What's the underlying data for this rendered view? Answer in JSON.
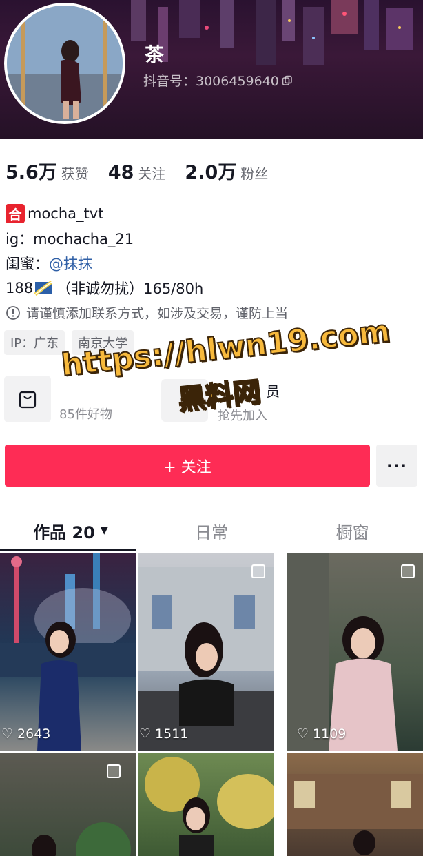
{
  "profile": {
    "nickname": "茶",
    "douyin_id": "抖音号：3006459640",
    "stats": [
      {
        "value": "5.6万",
        "label": "获赞"
      },
      {
        "value": "48",
        "label": "关注"
      },
      {
        "value": "2.0万",
        "label": "粉丝"
      }
    ],
    "bio": {
      "tag_char": "合",
      "line1": "mocha_tvt",
      "line2": "ig：mochacha_21",
      "line3_prefix": "闺蜜：",
      "line3_link": "@抹抹",
      "line4_a": "188",
      "line4_b": "（非诚勿扰）165/80h"
    },
    "notice": "请谨慎添加联系方式，如涉及交易，谨防上当",
    "chips": [
      "IP：广东",
      "南京大学"
    ]
  },
  "cards": {
    "shop_sub": "85件好物",
    "member_title": "员",
    "member_sub": "抢先加入"
  },
  "actions": {
    "follow_label": "+ 关注",
    "more_label": "···"
  },
  "tabs": [
    {
      "label": "作品 20",
      "active": true
    },
    {
      "label": "日常",
      "active": false
    },
    {
      "label": "橱窗",
      "active": false
    }
  ],
  "videos": [
    {
      "likes": "2643"
    },
    {
      "likes": "1511"
    },
    {
      "likes": "1109"
    },
    {
      "likes": ""
    },
    {
      "likes": ""
    },
    {
      "likes": ""
    }
  ],
  "watermark": {
    "line1": "https://hlwn19.com",
    "line2": "黑料网"
  },
  "colors": {
    "accent": "#fe2c55",
    "link": "#2f5fa6",
    "watermark": "#f7b93c"
  }
}
